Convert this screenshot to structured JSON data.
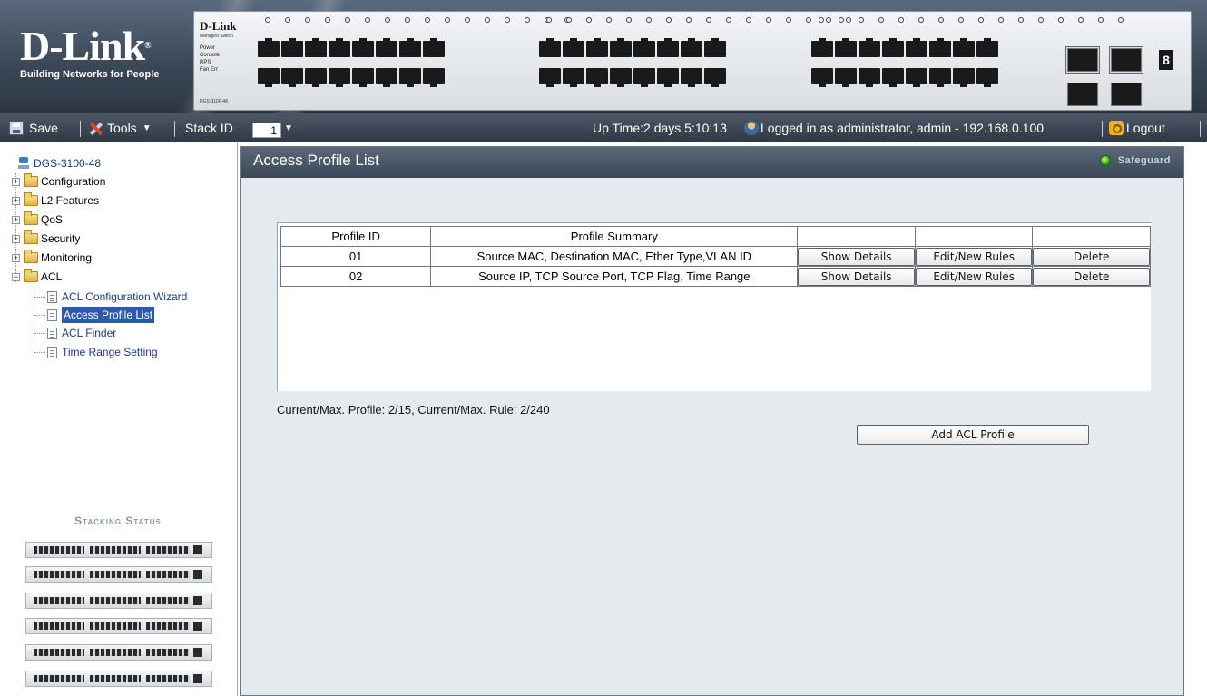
{
  "banner": {
    "brand": "D-Link",
    "tagline": "Building Networks for People",
    "device_brand": "D-Link",
    "device_sub": "Managed Switch",
    "device_leds": [
      "Power",
      "Console",
      "RPS",
      "Fan Err"
    ],
    "device_model": "DGS-3100-48",
    "seg_display": "8"
  },
  "toolbar": {
    "save_label": "Save",
    "tools_label": "Tools",
    "stack_id_label": "Stack ID",
    "stack_id_value": "1",
    "uptime": "Up Time:2 days 5:10:13",
    "login_text": "Logged in as administrator, admin - 192.168.0.100",
    "logout_label": "Logout"
  },
  "tree": {
    "root": "DGS-3100-48",
    "items": [
      {
        "label": "Configuration"
      },
      {
        "label": "L2 Features"
      },
      {
        "label": "QoS"
      },
      {
        "label": "Security"
      },
      {
        "label": "Monitoring"
      },
      {
        "label": "ACL"
      }
    ],
    "acl_children": [
      {
        "label": "ACL Configuration Wizard"
      },
      {
        "label": "Access Profile List"
      },
      {
        "label": "ACL Finder"
      },
      {
        "label": "Time Range Setting"
      }
    ],
    "selected": "Access Profile List"
  },
  "stacking": {
    "title": "Stacking Status",
    "unit_count": 6
  },
  "main": {
    "title": "Access Profile List",
    "safeguard_label": "Safeguard",
    "table": {
      "headers": [
        "Profile ID",
        "Profile Summary",
        "",
        "",
        ""
      ],
      "rows": [
        {
          "id": "01",
          "summary": "Source MAC, Destination MAC, Ether Type,VLAN ID",
          "show": "Show Details",
          "edit": "Edit/New Rules",
          "delete": "Delete"
        },
        {
          "id": "02",
          "summary": "Source IP, TCP Source Port, TCP Flag, Time Range",
          "show": "Show Details",
          "edit": "Edit/New Rules",
          "delete": "Delete"
        }
      ]
    },
    "summary_line": "Current/Max. Profile: 2/15, Current/Max. Rule: 2/240",
    "add_button": "Add ACL Profile"
  },
  "colors": {
    "banner": "#3c4958",
    "toolbar": "#2f3844",
    "panel_bg": "#e5eaee",
    "panel_header": "#4a5868",
    "selected": "#2a5aa8",
    "tree_link": "#1a3a8a",
    "safeguard_led": "#2a9a10"
  }
}
